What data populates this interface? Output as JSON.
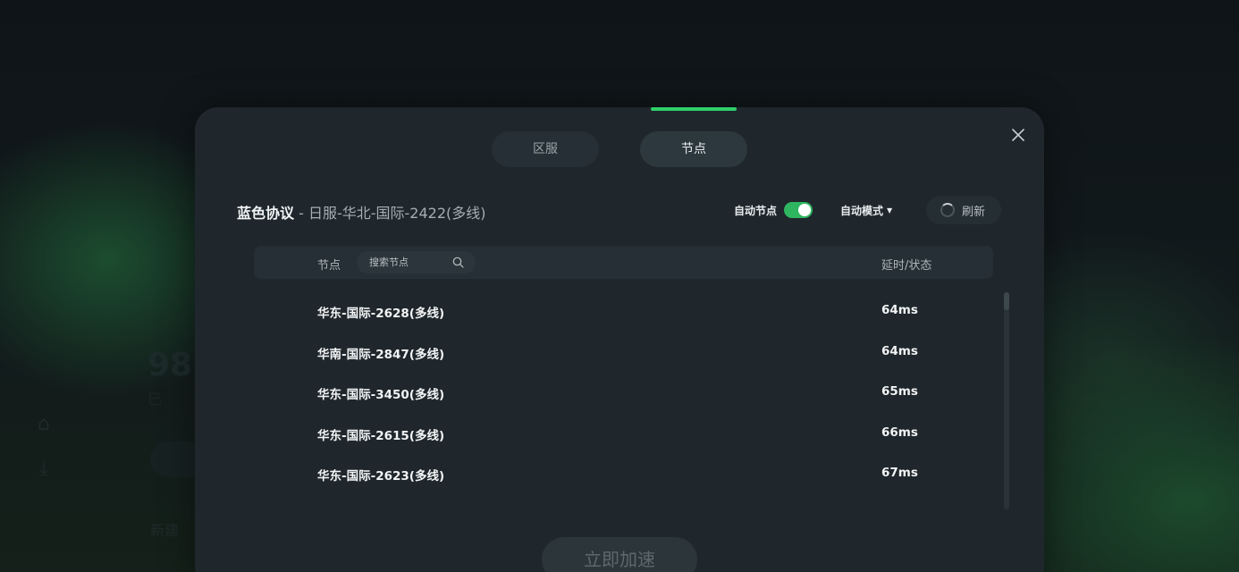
{
  "background": {
    "big_number": "98",
    "sub_text": "已",
    "new_label": "新建"
  },
  "modal": {
    "tabs": [
      {
        "label": "区服",
        "active": false
      },
      {
        "label": "节点",
        "active": true
      }
    ],
    "title": {
      "protocol": "蓝色协议",
      "separator": " - ",
      "current_node": "日服-华北-国际-2422(多线)"
    },
    "auto_node": {
      "label": "自动节点",
      "enabled": true
    },
    "auto_mode": {
      "label": "自动模式",
      "caret": "▼"
    },
    "refresh": {
      "label": "刷新"
    },
    "table": {
      "col_node": "节点",
      "search_placeholder": "搜索节点",
      "col_latency": "延时/状态",
      "rows": [
        {
          "name": "华东-国际-2628(多线)",
          "latency": "64ms"
        },
        {
          "name": "华南-国际-2847(多线)",
          "latency": "64ms"
        },
        {
          "name": "华东-国际-3450(多线)",
          "latency": "65ms"
        },
        {
          "name": "华东-国际-2615(多线)",
          "latency": "66ms"
        },
        {
          "name": "华东-国际-2623(多线)",
          "latency": "67ms"
        }
      ]
    },
    "accelerate_button": "立即加速"
  },
  "colors": {
    "accent": "#2fcf6a",
    "toggle_on": "#2fb560",
    "modal_bg": "#1f272c"
  },
  "icons": {
    "close": "close-icon",
    "search": "search-icon",
    "refresh": "spinner-icon",
    "dropdown": "caret-down-icon"
  }
}
